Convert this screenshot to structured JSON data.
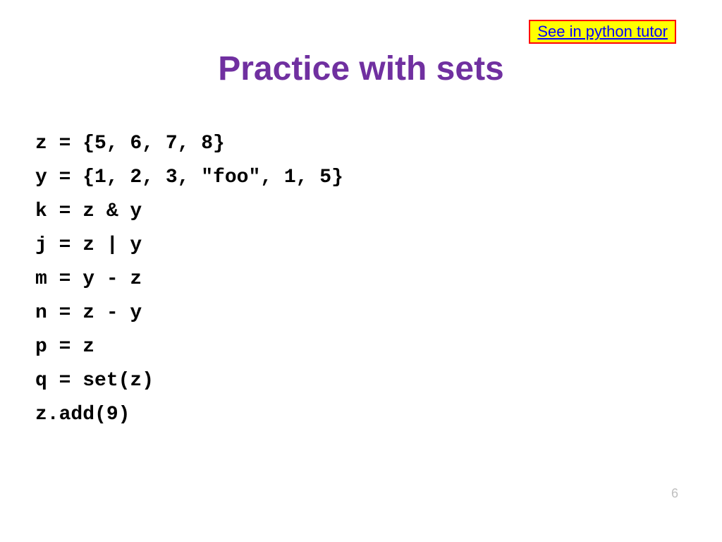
{
  "link": {
    "text": "See in python tutor"
  },
  "title": "Practice with sets",
  "code": {
    "lines": [
      "z = {5, 6, 7, 8}",
      "y = {1, 2, 3, \"foo\", 1, 5}",
      "k = z & y",
      "j = z | y",
      "m = y - z",
      "n = z - y",
      "p = z",
      "q = set(z)",
      "z.add(9)"
    ]
  },
  "page_number": "6"
}
